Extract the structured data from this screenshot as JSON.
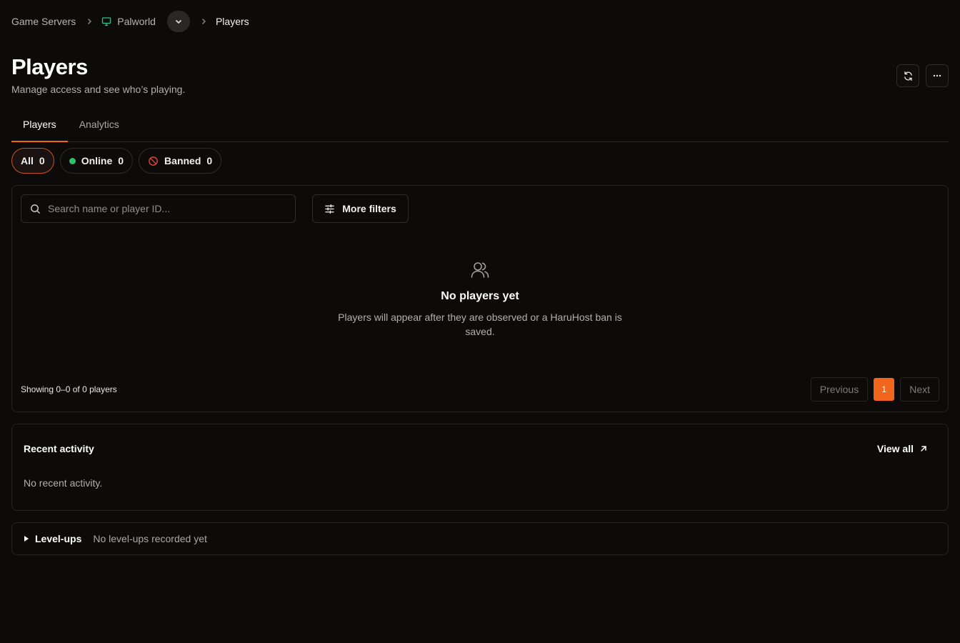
{
  "breadcrumb": {
    "root": "Game Servers",
    "server": "Palworld",
    "current": "Players"
  },
  "header": {
    "title": "Players",
    "subtitle": "Manage access and see who’s playing."
  },
  "tabs": [
    {
      "label": "Players",
      "active": true
    },
    {
      "label": "Analytics",
      "active": false
    }
  ],
  "filters": {
    "all": {
      "label": "All",
      "count": "0"
    },
    "online": {
      "label": "Online",
      "count": "0"
    },
    "banned": {
      "label": "Banned",
      "count": "0"
    }
  },
  "players_card": {
    "search_placeholder": "Search name or player ID...",
    "more_filters_label": "More filters",
    "empty_title": "No players yet",
    "empty_description": "Players will appear after they are observed or a HaruHost ban is saved.",
    "showing_text": "Showing 0–0 of 0 players",
    "pagination": {
      "previous_label": "Previous",
      "current_page": "1",
      "next_label": "Next"
    }
  },
  "recent_activity": {
    "title": "Recent activity",
    "view_all_label": "View all",
    "empty_text": "No recent activity."
  },
  "level_ups": {
    "title": "Level-ups",
    "note": "No level-ups recorded yet"
  },
  "icons": {
    "server": "monitor-icon",
    "dropdown": "chevron-down-icon",
    "separator": "chevron-right-icon",
    "refresh": "refresh-icon",
    "more": "more-horizontal-icon",
    "search": "search-icon",
    "filters": "sliders-icon",
    "empty": "users-icon",
    "banned": "ban-icon",
    "view_all": "arrow-up-right-icon",
    "expand": "triangle-right-icon"
  },
  "colors": {
    "accent": "#f2651c",
    "online": "#2fbf6a",
    "banned": "#e0443a",
    "server_icon": "#2fbf8f"
  }
}
